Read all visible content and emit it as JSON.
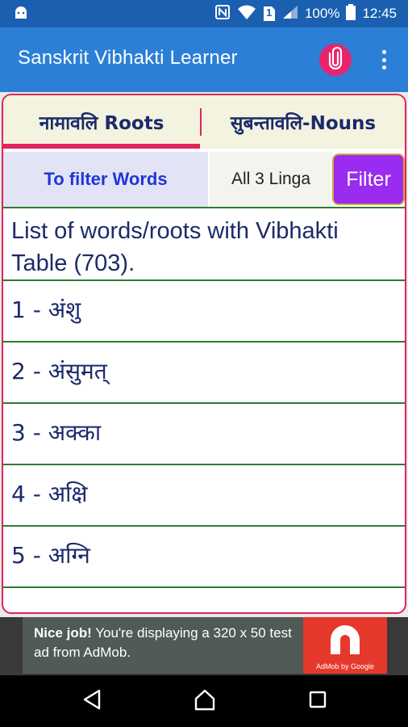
{
  "status_bar": {
    "battery_percent": "100%",
    "time": "12:45",
    "sim_badge": "1",
    "icons": [
      "android-icon",
      "nfc-icon",
      "wifi-icon",
      "sim-icon",
      "signal-icon",
      "battery-icon"
    ]
  },
  "app_bar": {
    "title": "Sanskrit Vibhakti Learner",
    "icons": [
      "paperclip-icon",
      "more-vert-icon"
    ],
    "accent": "#e8246b",
    "background": "#2b7fd6"
  },
  "tabs": [
    {
      "label": "नामावलि Roots",
      "selected": true
    },
    {
      "label": "सुबन्तावलि-Nouns",
      "selected": false
    }
  ],
  "filter": {
    "label": "To filter Words",
    "selected_value": "All 3 Linga",
    "button_label": "Filter"
  },
  "list": {
    "header": "List of words/roots with Vibhakti Table (703).",
    "items": [
      "1 - अंशु",
      "2 - अंसुमत्",
      "3 - अक्का",
      "4 - अक्षि",
      "5 - अग्नि",
      ""
    ]
  },
  "ad": {
    "bold_text": "Nice job!",
    "text": " You're displaying a 320 x 50 test ad from AdMob.",
    "brand": "AdMob by Google"
  },
  "nav_bar": {
    "icons": [
      "back-icon",
      "home-icon",
      "recents-icon"
    ]
  },
  "colors": {
    "primary": "#2b7fd6",
    "status": "#1b5fb0",
    "accent": "#e0245e",
    "filter_button": "#9a2bf0",
    "divider": "#2e7d32",
    "text": "#1b2a6b"
  }
}
